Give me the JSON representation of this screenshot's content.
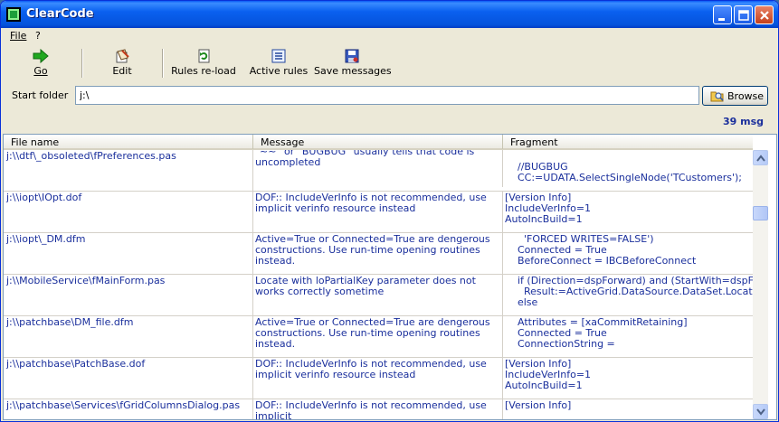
{
  "window": {
    "title": "ClearCode"
  },
  "menu": {
    "file": "File",
    "help": "?"
  },
  "toolbar": {
    "go": "Go",
    "edit": "Edit",
    "reload": "Rules re-load",
    "active": "Active rules",
    "save": "Save messages"
  },
  "folder": {
    "label": "Start folder",
    "value": "j:\\",
    "browse": "Browse"
  },
  "status": {
    "count": "39 msg"
  },
  "grid": {
    "columns": [
      "File name",
      "Message",
      "Fragment"
    ],
    "rows": [
      {
        "file": "j:\\\\dtf\\_obsoleted\\fPreferences.pas",
        "message": "\"~~\" or \"BUGBUG\" usually tells that code is uncompleted",
        "fragment": "\n    //BUGBUG\n    CC:=UDATA.SelectSingleNode('TCustomers');"
      },
      {
        "file": "j:\\\\iopt\\IOpt.dof",
        "message": "DOF:: IncludeVerInfo is not recommended, use implicit verinfo resource instead",
        "fragment": "[Version Info]\nIncludeVerInfo=1\nAutoIncBuild=1"
      },
      {
        "file": "j:\\\\iopt\\_DM.dfm",
        "message": "Active=True or Connected=True are dengerous constructions. Use run-time opening routines instead.",
        "fragment": "      'FORCED WRITES=FALSE')\n    Connected = True\n    BeforeConnect = IBCBeforeConnect"
      },
      {
        "file": "j:\\\\MobileService\\fMainForm.pas",
        "message": "Locate with loPartialKey parameter does not works correctly sometime",
        "fragment": "    if (Direction=dspForward) and (StartWith=dspFirst) and (\n      Result:=ActiveGrid.DataSource.DataSet.Locate(FI.Fie\n    else"
      },
      {
        "file": "j:\\\\patchbase\\DM_file.dfm",
        "message": "Active=True or Connected=True are dengerous constructions. Use run-time opening routines instead.",
        "fragment": "    Attributes = [xaCommitRetaining]\n    Connected = True\n    ConnectionString ="
      },
      {
        "file": "j:\\\\patchbase\\PatchBase.dof",
        "message": "DOF:: IncludeVerInfo is not recommended, use implicit verinfo resource instead",
        "fragment": "[Version Info]\nIncludeVerInfo=1\nAutoIncBuild=1"
      },
      {
        "file": "j:\\\\patchbase\\Services\\fGridColumnsDialog.pas",
        "message": "DOF:: IncludeVerInfo is not recommended, use implicit",
        "fragment": "[Version Info]"
      }
    ]
  }
}
